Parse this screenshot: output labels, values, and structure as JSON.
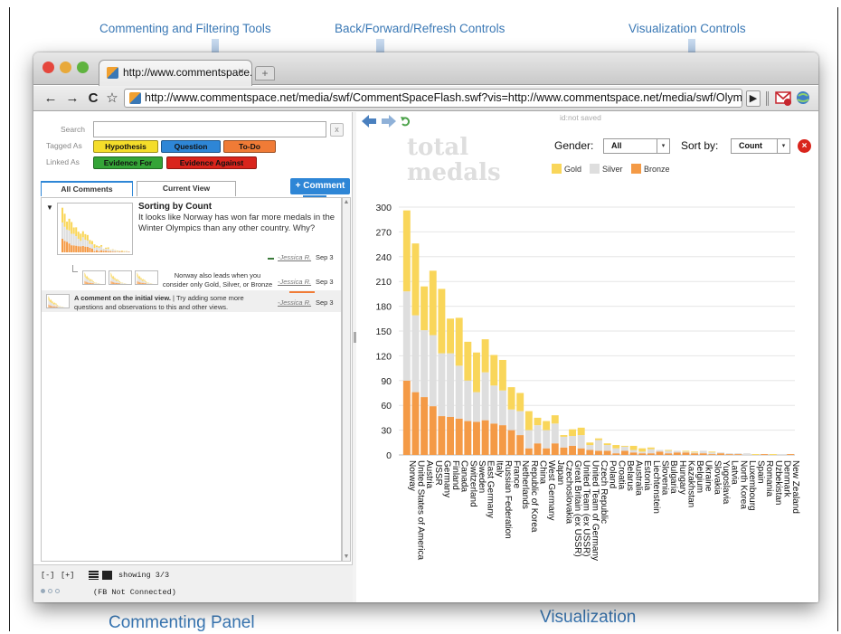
{
  "callouts": {
    "commenting_filtering": "Commenting and Filtering Tools",
    "back_forward_refresh": "Back/Forward/Refresh Controls",
    "visualization_controls": "Visualization Controls",
    "commenting_panel": "Commenting Panel",
    "visualization": "Visualization"
  },
  "browser": {
    "tab_title": "http://www.commentspace.",
    "tab_close": "×",
    "new_tab": "+",
    "back": "←",
    "forward": "→",
    "reload": "C",
    "star": "☆",
    "url": "http://www.commentspace.net/media/swf/CommentSpaceFlash.swf?vis=http://www.commentspace.net/media/swf/Olympi",
    "play": "▶",
    "colors": {
      "close": "#e5473d",
      "minimize": "#e8a93a",
      "maximize": "#5fb33f"
    }
  },
  "left_panel": {
    "search_label": "Search",
    "search_value": "",
    "search_clear": "x",
    "tagged_as_label": "Tagged As",
    "linked_as_label": "Linked As",
    "tags": [
      {
        "label": "Hypothesis",
        "color": "#f4dd2a"
      },
      {
        "label": "Question",
        "color": "#2e86d6"
      },
      {
        "label": "To-Do",
        "color": "#f07b36"
      }
    ],
    "links": [
      {
        "label": "Evidence For",
        "color": "#34a437"
      },
      {
        "label": "Evidence Against",
        "color": "#d9241c"
      }
    ],
    "tabs": [
      {
        "label": "All Comments",
        "active": true
      },
      {
        "label": "Current View",
        "active": false
      }
    ],
    "comment_button": "+ Comment",
    "comments": [
      {
        "title": "Sorting by Count",
        "body": "It looks like Norway has won far more medals in the Winter Olympics than any other country. Why?",
        "author": "-Jessica R.",
        "date": "Sep 3",
        "collapse": "▼"
      },
      {
        "body": "Norway also leads when you consider only Gold, Silver, or Bronze medals.",
        "author": "-Jessica R.",
        "date": "Sep 3"
      },
      {
        "title": "A comment on the initial view.",
        "body": " | Try adding some more questions and observations to this and other views.",
        "author": "-Jessica R.",
        "date": "Sep 3"
      }
    ],
    "scroll_up": "▲",
    "scroll_down": "▼",
    "footer": {
      "collapse": "[-]",
      "expand": "[+]",
      "showing": "showing 3/3",
      "fb_status": "(FB Not Connected)"
    }
  },
  "viz": {
    "status": "id:not saved",
    "title_line1": "total",
    "title_line2": "medals",
    "gender_label": "Gender:",
    "gender_value": "All",
    "sort_label": "Sort by:",
    "sort_value": "Count",
    "close": "×",
    "select_arrow": "▾",
    "nav": {
      "back": "◀",
      "forward": "▶",
      "refresh": "⟳"
    }
  },
  "chart_data": {
    "type": "bar",
    "stacked": true,
    "ylim": [
      0,
      300
    ],
    "yticks": [
      0,
      30,
      60,
      90,
      120,
      150,
      180,
      210,
      240,
      270,
      300
    ],
    "grid": true,
    "legend_position": "top",
    "categories": [
      "Norway",
      "United States of America",
      "Austria",
      "USSR",
      "Germany",
      "Finland",
      "Canada",
      "Switzerland",
      "Sweden",
      "East Germany",
      "Italy",
      "Russian Federation",
      "France",
      "Netherlands",
      "Republic of Korea",
      "China",
      "West Germany",
      "Japan",
      "Czechoslovakia",
      "Great Britain (ex USSR)",
      "United Team (ex USSR)",
      "United Team of Germany",
      "Czech Republic",
      "Poland",
      "Croatia",
      "Belarus",
      "Australia",
      "Estonia",
      "Liechtenstein",
      "Slovenia",
      "Bulgaria",
      "Hungary",
      "Kazakhstan",
      "Belgium",
      "Ukraine",
      "Slovakia",
      "Yugoslavia",
      "Latvia",
      "North Korea",
      "Luxembourg",
      "Spain",
      "Romania",
      "Uzbekistan",
      "Denmark",
      "New Zealand"
    ],
    "series": [
      {
        "name": "Bronze",
        "color": "#f49a46",
        "values": [
          90,
          76,
          70,
          59,
          47,
          46,
          44,
          41,
          40,
          42,
          38,
          36,
          30,
          24,
          8,
          14,
          8,
          14,
          9,
          11,
          8,
          6,
          5,
          5,
          2,
          5,
          3,
          2,
          2,
          4,
          2,
          3,
          3,
          2,
          2,
          1,
          2,
          1,
          1,
          0,
          0,
          1,
          0,
          0,
          1
        ]
      },
      {
        "name": "Silver",
        "color": "#dedede",
        "values": [
          108,
          93,
          81,
          86,
          76,
          77,
          64,
          49,
          36,
          58,
          46,
          42,
          25,
          29,
          22,
          22,
          22,
          24,
          13,
          12,
          16,
          6,
          13,
          7,
          6,
          5,
          3,
          2,
          5,
          2,
          3,
          2,
          1,
          1,
          3,
          2,
          1,
          1,
          1,
          2,
          0,
          0,
          0,
          1,
          0
        ]
      },
      {
        "name": "Gold",
        "color": "#f9d65a",
        "values": [
          98,
          87,
          53,
          78,
          78,
          42,
          58,
          47,
          48,
          40,
          37,
          37,
          27,
          22,
          23,
          9,
          11,
          10,
          2,
          8,
          9,
          3,
          2,
          2,
          4,
          1,
          5,
          4,
          2,
          0,
          1,
          0,
          1,
          1,
          0,
          1,
          0,
          0,
          0,
          0,
          1,
          0,
          1,
          0,
          0
        ]
      }
    ]
  }
}
